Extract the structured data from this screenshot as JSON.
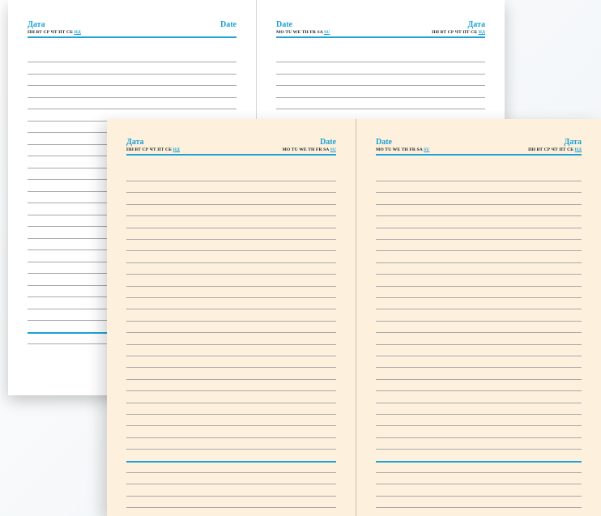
{
  "header": {
    "word_ru": "Дата",
    "word_en": "Date",
    "days_ru": [
      "ПН",
      "ВТ",
      "СР",
      "ЧТ",
      "ПТ",
      "СБ"
    ],
    "sun_ru": "НД",
    "days_en": [
      "MO",
      "TU",
      "WE",
      "TH",
      "FR",
      "SA"
    ],
    "sun_en": "SU"
  },
  "colors": {
    "accent": "#1da1d6",
    "cream_paper": "#fdf0dc",
    "white_paper": "#ffffff",
    "rule_line": "#a9a9a9"
  },
  "notebooks": [
    {
      "name": "white",
      "left_page_header": "ru",
      "right_page_header": "en"
    },
    {
      "name": "cream",
      "left_page_header": "ru",
      "right_page_header": "en"
    }
  ]
}
